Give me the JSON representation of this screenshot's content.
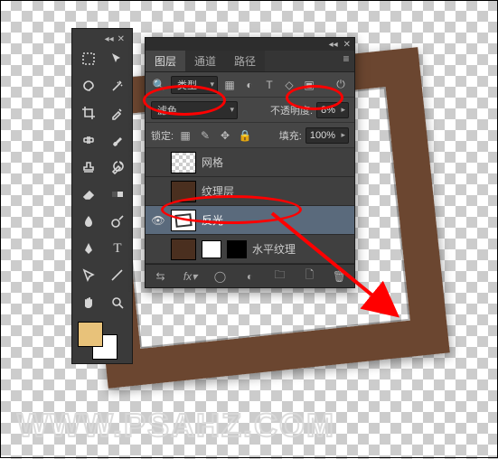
{
  "tools": {
    "items": [
      "move",
      "marquee",
      "lasso",
      "wand",
      "crop",
      "eyedropper",
      "heal",
      "brush",
      "stamp",
      "history",
      "eraser",
      "gradient",
      "blur",
      "dodge",
      "pen",
      "type",
      "path-sel",
      "shape",
      "hand",
      "zoom"
    ],
    "cursor_tool": "cursor",
    "swap_icon": "swap"
  },
  "layers_panel": {
    "tabs": [
      "图层",
      "通道",
      "路径"
    ],
    "active_tab": 0,
    "kind_label": "类型",
    "blend_mode": "滤色",
    "opacity_label": "不透明度:",
    "opacity_value": "8%",
    "lock_label": "锁定:",
    "fill_label": "填充:",
    "fill_value": "100%",
    "visible_layer_index": 2,
    "selected_layer_index": 2,
    "layers": [
      {
        "name": "网格"
      },
      {
        "name": "纹理层"
      },
      {
        "name": "反光"
      },
      {
        "name": "水平纹理"
      }
    ],
    "type_icons": [
      "image",
      "adjust",
      "type",
      "shape",
      "smart"
    ]
  },
  "watermark": "WWW.PSAHZ.COM"
}
